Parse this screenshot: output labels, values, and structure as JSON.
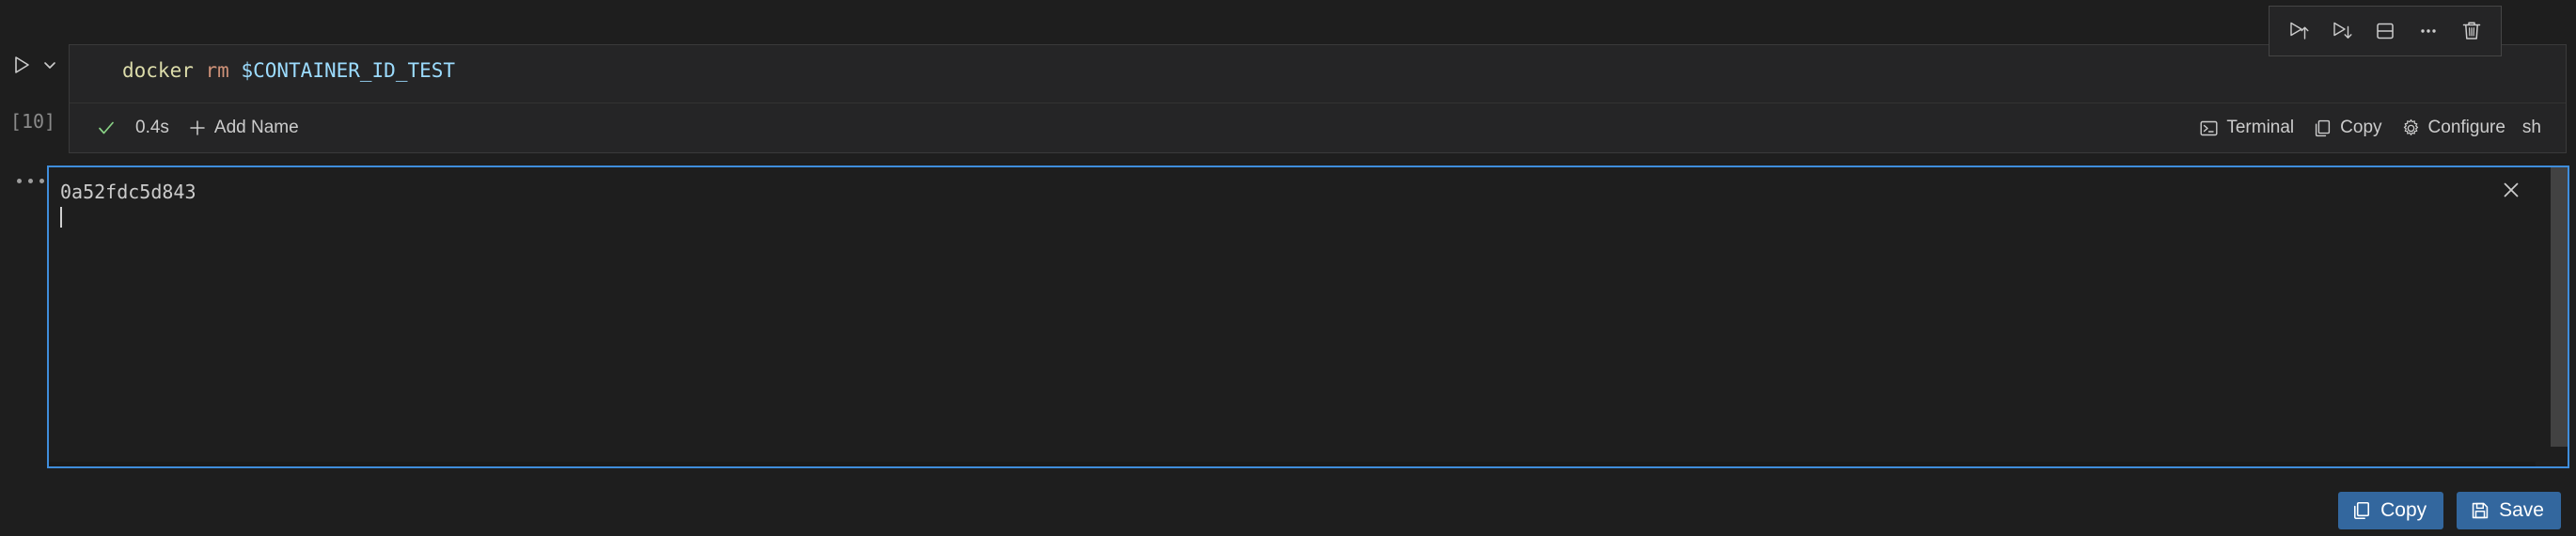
{
  "cell": {
    "execution_count": "[10]",
    "language": "sh",
    "code": {
      "command": "docker",
      "subcommand": "rm",
      "argument": "$CONTAINER_ID_TEST",
      "full_text": "docker rm $CONTAINER_ID_TEST"
    },
    "status": {
      "success_icon": "check-icon",
      "duration": "0.4s",
      "add_name_label": "Add Name",
      "add_name_icon": "plus-icon"
    },
    "status_actions": [
      {
        "label": "Terminal",
        "icon": "terminal-icon"
      },
      {
        "label": "Copy",
        "icon": "copy-icon"
      },
      {
        "label": "Configure",
        "icon": "gear-icon"
      }
    ],
    "toolbar": [
      {
        "name": "run-above-button",
        "icon": "play-up-icon",
        "title": "Execute Above Cells"
      },
      {
        "name": "run-below-button",
        "icon": "play-down-icon",
        "title": "Execute Cell and Below"
      },
      {
        "name": "split-cell-button",
        "icon": "split-cell-icon",
        "title": "Split Cell"
      },
      {
        "name": "more-actions-button",
        "icon": "ellipsis-icon",
        "title": "More Actions..."
      },
      {
        "name": "delete-cell-button",
        "icon": "trash-icon",
        "title": "Delete Cell"
      }
    ],
    "gutter": {
      "run_icon": "play-icon",
      "chevron_icon": "chevron-down-icon",
      "output_toggle_icon": "ellipsis-icon"
    }
  },
  "output": {
    "text": "0a52fdc5d843",
    "close_icon": "close-icon",
    "has_cursor": true
  },
  "actions": [
    {
      "label": "Copy",
      "icon": "copy-icon"
    },
    {
      "label": "Save",
      "icon": "save-icon"
    }
  ],
  "colors": {
    "background": "#1e1e1e",
    "cell_background": "#252526",
    "focus_border": "#3f8ddb",
    "button_blue": "#33679e",
    "success_green": "#89d185",
    "token_command": "#dcdcaa",
    "token_argument": "#ce9178",
    "token_variable": "#9cdcfe"
  }
}
